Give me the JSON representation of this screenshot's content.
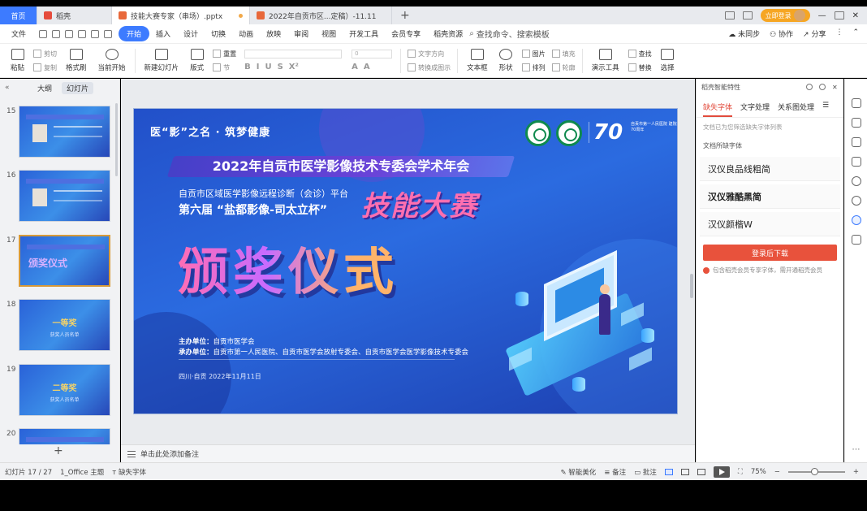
{
  "tabs": [
    {
      "label": "首页",
      "kind": "home"
    },
    {
      "label": "稻壳",
      "kind": "docer"
    },
    {
      "label": "技能大赛专家（串场）.pptx",
      "kind": "doc-active"
    },
    {
      "label": "2022年自贡市区...定稿）-11.11",
      "kind": "doc"
    }
  ],
  "tabbar": {
    "login_label": "立即登录"
  },
  "menu": {
    "file": "文件",
    "items": [
      "开始",
      "插入",
      "设计",
      "切换",
      "动画",
      "放映",
      "审阅",
      "视图",
      "开发工具",
      "会员专享",
      "稻壳资源"
    ],
    "active_index": 0,
    "search_placeholder": "查找命令、搜索模板",
    "sync": "未同步",
    "collab": "协作",
    "share": "分享"
  },
  "ribbon": {
    "paste": "粘贴",
    "cut": "剪切",
    "copy": "复制",
    "format_painter": "格式刷",
    "from_current": "当前开始",
    "new_slide": "新建幻灯片",
    "layout": "版式",
    "section": "节",
    "reset": "重置",
    "textbox": "文本框",
    "shape": "形状",
    "arrange": "排列",
    "outline": "轮廓",
    "picture": "图片",
    "fill": "填充",
    "presenter_tools": "演示工具",
    "replace": "替换",
    "find": "查找",
    "select": "选择",
    "text_direction": "文字方向",
    "convert_smartart": "转换成图示",
    "font_size": "0"
  },
  "left_panel": {
    "tab_outline": "大纲",
    "tab_slides": "幻灯片",
    "slides": [
      {
        "num": "15",
        "type": "profile"
      },
      {
        "num": "16",
        "type": "profile"
      },
      {
        "num": "17",
        "type": "title",
        "text": "颁奖仪式",
        "active": true
      },
      {
        "num": "18",
        "type": "award",
        "text": "一等奖",
        "sub": "获奖人员名单"
      },
      {
        "num": "19",
        "type": "award",
        "text": "二等奖",
        "sub": "获奖人员名单"
      },
      {
        "num": "20",
        "type": "profile"
      }
    ]
  },
  "slide": {
    "motto": "医“影”之名 · 筑梦健康",
    "banner": "2022年自贡市医学影像技术专委会学术年会",
    "platform": "自贡市区域医学影像远程诊断（会诊）平台",
    "session": "第六届 “盐都影像-司太立杯”",
    "contest": "技能大赛",
    "ceremony": "颁奖仪式",
    "host_label": "主办单位：",
    "host": "自贡市医学会",
    "cohost_label": "承办单位：",
    "cohost": "自贡市第一人民医院、自贡市医学会放射专委会、自贡市医学会医学影像技术专委会",
    "date": "四川·自贡  2022年11月11日",
    "logo_70": "70",
    "logo_70_text": "自贡市第一人民医院 建院70周年"
  },
  "notes_placeholder": "单击此处添加备注",
  "right_panel": {
    "title": "稻壳智能特性",
    "tabs": [
      "缺失字体",
      "文字处理",
      "关系图处理"
    ],
    "active_tab": 0,
    "hint": "文档已为您筛选缺失字体列表",
    "section_label": "文档所缺字体",
    "fonts": [
      "汉仪良品线粗简",
      "汉仪雅酷黑简",
      "汉仪颜楷W"
    ],
    "download_button": "登录后下载",
    "note": "包含稻壳会员专享字体，需开通稻壳会员"
  },
  "statusbar": {
    "slide_counter": "幻灯片 17 / 27",
    "theme": "1_Office 主题",
    "missing_font": "缺失字体",
    "smart_beautify": "智能美化",
    "notes": "备注",
    "comments": "批注",
    "zoom": "75%"
  },
  "colors": {
    "accent": "#3d7bff",
    "slide_blue": "#2b6be0",
    "download_red": "#e8523c",
    "active_thumb_border": "#d79a3a"
  }
}
